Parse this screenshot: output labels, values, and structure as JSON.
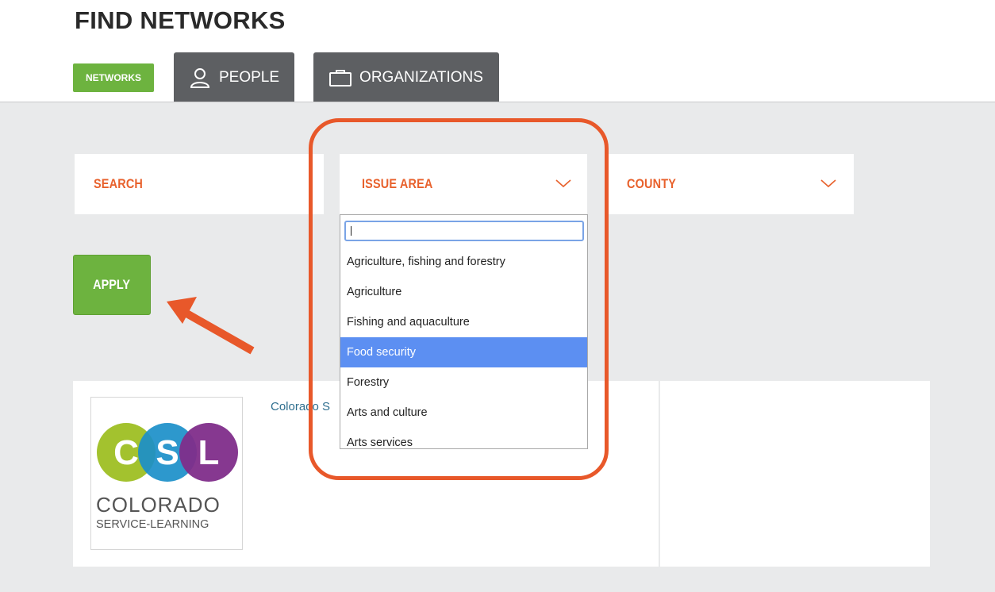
{
  "page": {
    "title": "FIND NETWORKS"
  },
  "tabs": {
    "networks": "NETWORKS",
    "people": "PEOPLE",
    "organizations": "ORGANIZATIONS"
  },
  "filters": {
    "search_label": "SEARCH",
    "issue_area_label": "ISSUE AREA",
    "county_label": "COUNTY"
  },
  "apply_label": "APPLY",
  "dropdown": {
    "input_value": "",
    "options": [
      "Agriculture, fishing and forestry",
      "Agriculture",
      "Fishing and aquaculture",
      "Food security",
      "Forestry",
      "Arts and culture",
      "Arts services"
    ],
    "highlighted_option": "Food security"
  },
  "results": {
    "network_name": "Colorado S",
    "logo": {
      "letters": [
        "C",
        "S",
        "L"
      ],
      "line1": "COLORADO",
      "line2": "SERVICE-LEARNING"
    }
  },
  "colors": {
    "accent_orange": "#e8612c",
    "green": "#6db33f",
    "tab_gray": "#5d5f62",
    "highlight_blue": "#5c8ff2"
  },
  "icons": [
    "person-icon",
    "briefcase-icon",
    "chevron-down-icon",
    "arrow-icon"
  ]
}
